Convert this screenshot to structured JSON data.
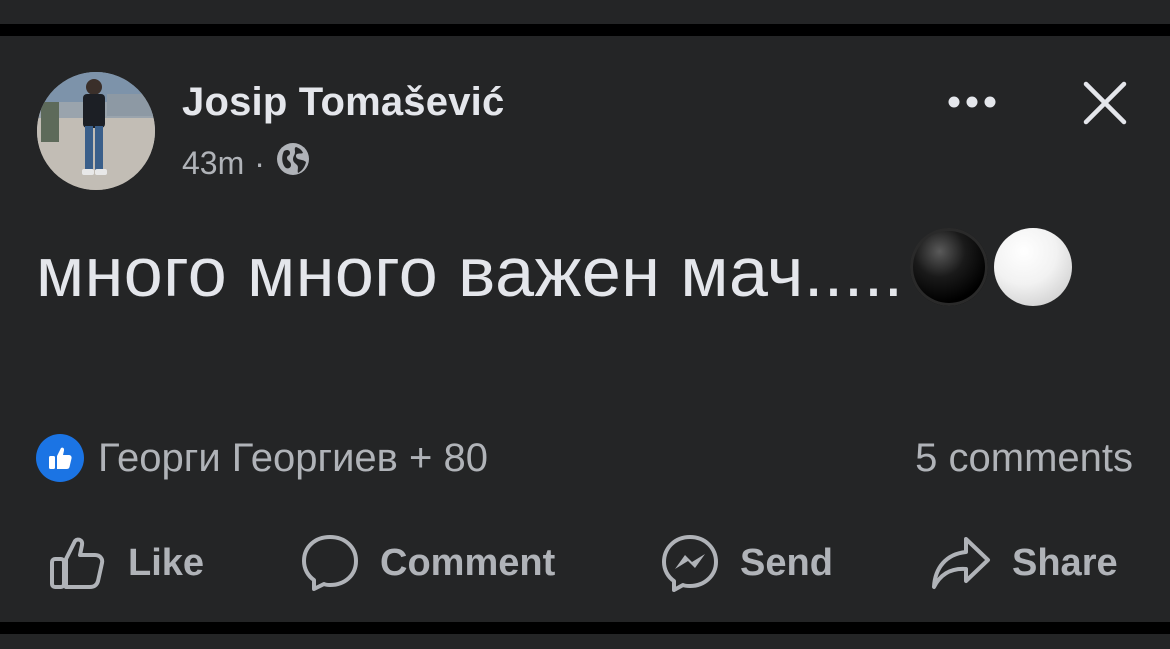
{
  "post": {
    "author": "Josip Tomašević",
    "time": "43m",
    "separator": "·",
    "privacy_icon": "globe-icon",
    "text": "много много важен мач.....",
    "emojis": [
      "black-circle",
      "white-circle"
    ]
  },
  "header_actions": {
    "more_icon": "more-horizontal-icon",
    "close_icon": "close-icon"
  },
  "reactions": {
    "icon": "like-badge-icon",
    "summary": "Георги Георгиев + 80"
  },
  "comments": {
    "count_label": "5 comments"
  },
  "actions": {
    "like": "Like",
    "comment": "Comment",
    "send": "Send",
    "share": "Share"
  },
  "colors": {
    "background": "#000000",
    "card": "#242526",
    "primary_text": "#e4e6eb",
    "secondary_text": "#b0b3b8",
    "like_blue": "#1b74e4"
  }
}
